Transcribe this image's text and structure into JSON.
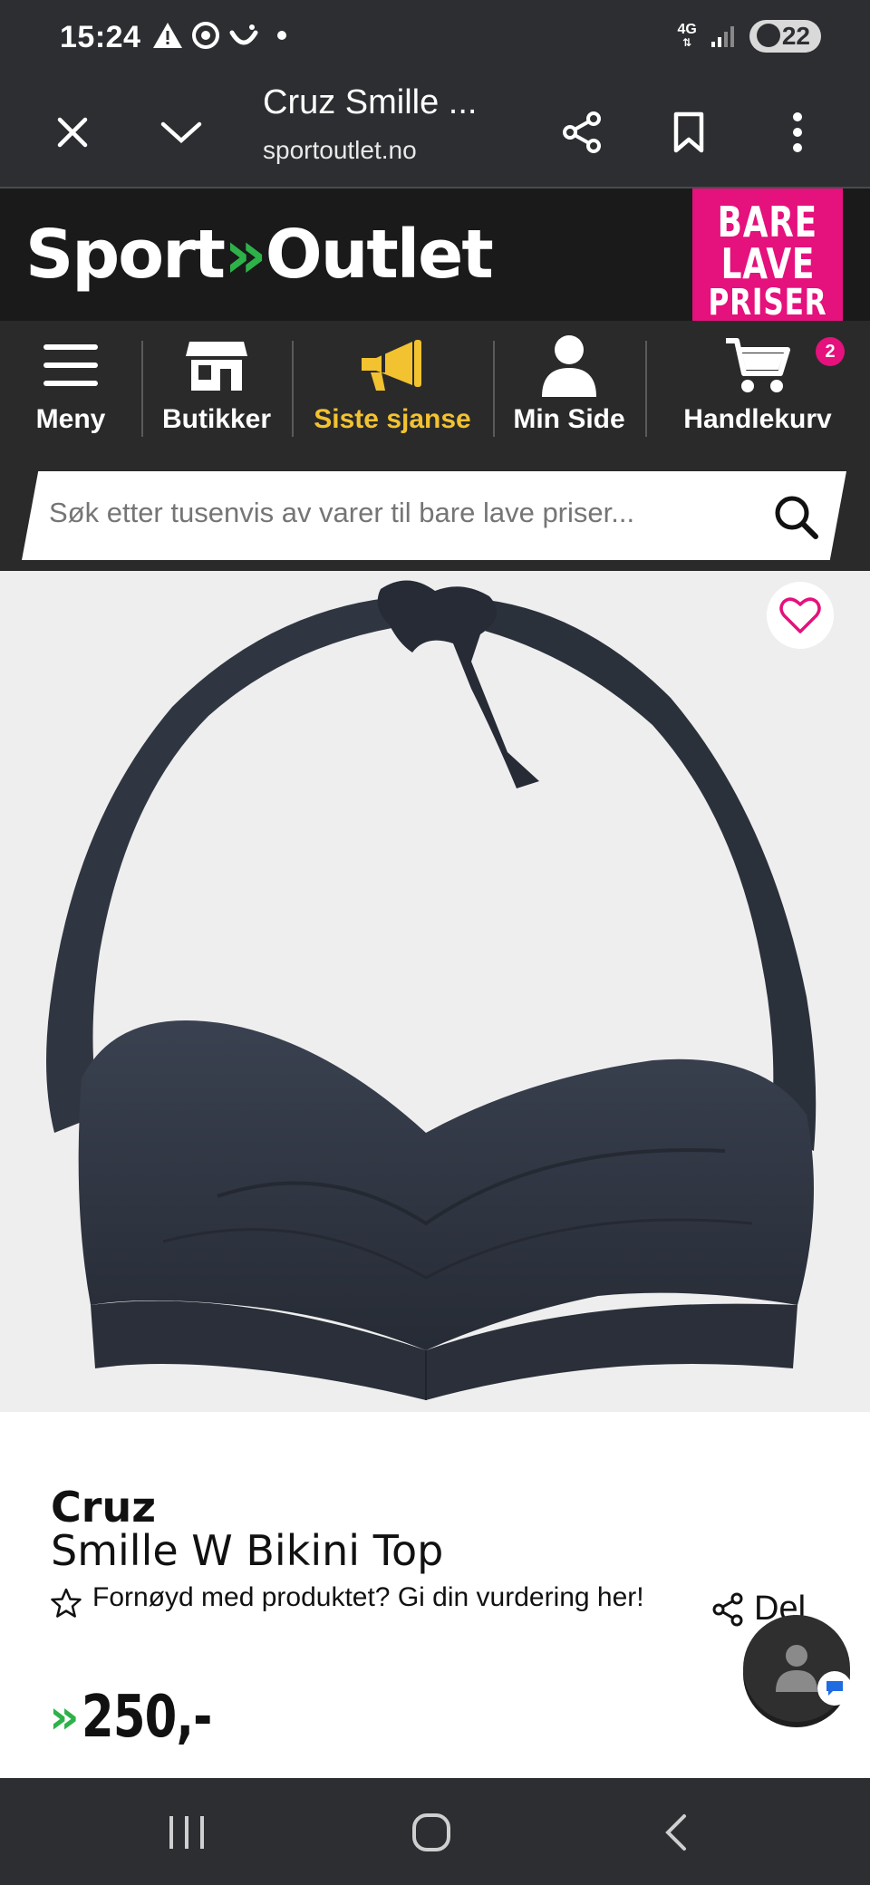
{
  "status_bar": {
    "time": "15:24",
    "network": "4G",
    "battery": "22",
    "icons": [
      "warning-icon",
      "chrome-icon",
      "smile-icon",
      "dot-icon",
      "signal-icon",
      "battery-icon"
    ]
  },
  "browser": {
    "title": "Cruz Smille ...",
    "url": "sportoutlet.no",
    "buttons": [
      "close-icon",
      "chevron-down-icon",
      "share-icon",
      "bookmark-icon",
      "more-icon"
    ]
  },
  "site": {
    "logo_left": "Sport",
    "logo_right": "Outlet",
    "promo_lines": [
      "BARE",
      "LAVE",
      "PRISER"
    ]
  },
  "nav": {
    "items": [
      {
        "label": "Meny",
        "icon": "menu-icon"
      },
      {
        "label": "Butikker",
        "icon": "store-icon"
      },
      {
        "label": "Siste sjanse",
        "icon": "megaphone-icon"
      },
      {
        "label": "Min Side",
        "icon": "user-icon"
      },
      {
        "label": "Handlekurv",
        "icon": "cart-icon"
      }
    ],
    "cart_count": "2",
    "highlight_color": "#f2c230"
  },
  "search": {
    "placeholder": "Søk etter tusenvis av varer til bare lave priser..."
  },
  "product": {
    "brand": "Cruz",
    "name": "Smille W Bikini Top",
    "rating_prompt": "Fornøyd med produktet? Gi din vurdering her!",
    "share_label": "Del",
    "price": "250,-"
  },
  "colors": {
    "brand_green": "#2db24a",
    "brand_pink": "#e5117c"
  }
}
